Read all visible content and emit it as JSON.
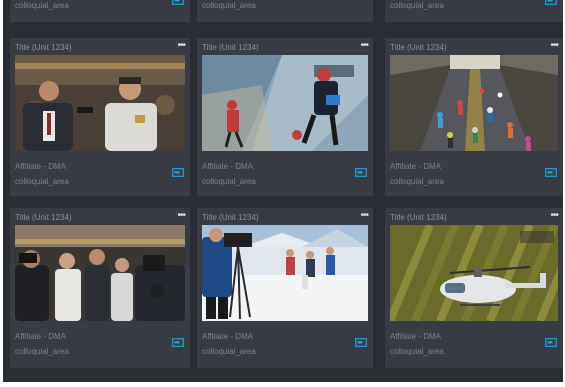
{
  "top_row": [
    {
      "area": "colloquial_area"
    },
    {
      "area": "colloquial_area"
    },
    {
      "area": "colloquial_area"
    }
  ],
  "cards": [
    {
      "title": "Title (Unit 1234)",
      "affiliate": "Affiliate - DMA",
      "area": "colloquial_area",
      "thumbnail": "interview-reporter-athlete"
    },
    {
      "title": "Title (Unit 1234)",
      "affiliate": "Affiliate - DMA",
      "area": "colloquial_area",
      "thumbnail": "ski-racers-aerial"
    },
    {
      "title": "Title (Unit 1234)",
      "affiliate": "Affiliate - DMA",
      "area": "colloquial_area",
      "thumbnail": "marathon-runners-street"
    },
    {
      "title": "Title (Unit 1234)",
      "affiliate": "Affiliate - DMA",
      "area": "colloquial_area",
      "thumbnail": "press-crowd-cameras"
    },
    {
      "title": "Title (Unit 1234)",
      "affiliate": "Affiliate - DMA",
      "area": "colloquial_area",
      "thumbnail": "cameraman-snow-slope"
    },
    {
      "title": "Title (Unit 1234)",
      "affiliate": "Affiliate - DMA",
      "area": "colloquial_area",
      "thumbnail": "helicopter-over-vineyard"
    }
  ],
  "icons": {
    "more": "more-icon",
    "cast": "cast-icon"
  },
  "colors": {
    "background": "#2b2d35",
    "card": "#3a3c45",
    "accent": "#1fa3d8"
  }
}
